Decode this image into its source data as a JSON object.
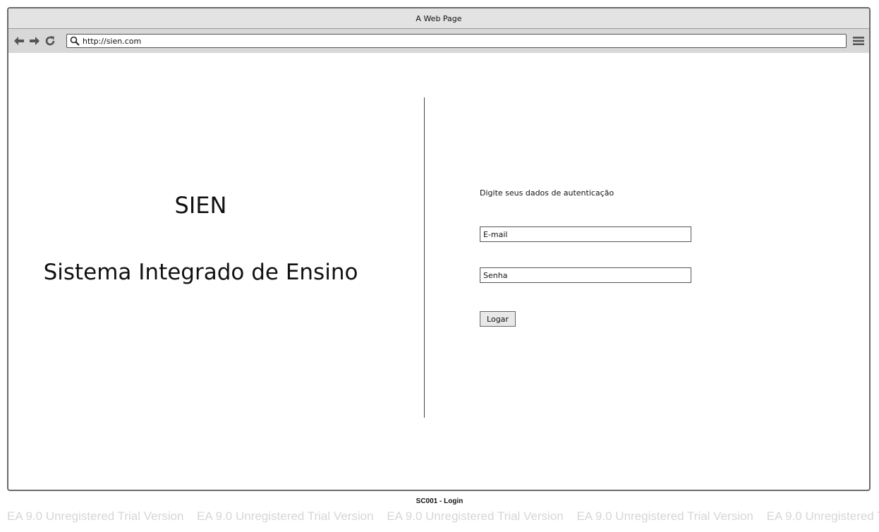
{
  "browser": {
    "title": "A Web Page",
    "url": "http://sien.com"
  },
  "left": {
    "app_short_name": "SIEN",
    "app_full_name": "Sistema Integrado de Ensino"
  },
  "login": {
    "instruction": "Digite seus dados de autenticação",
    "email_placeholder": "E-mail",
    "password_placeholder": "Senha",
    "submit_label": "Logar"
  },
  "diagram": {
    "caption": "SC001 - Login",
    "watermark": "EA 9.0 Unregistered Trial Version"
  }
}
